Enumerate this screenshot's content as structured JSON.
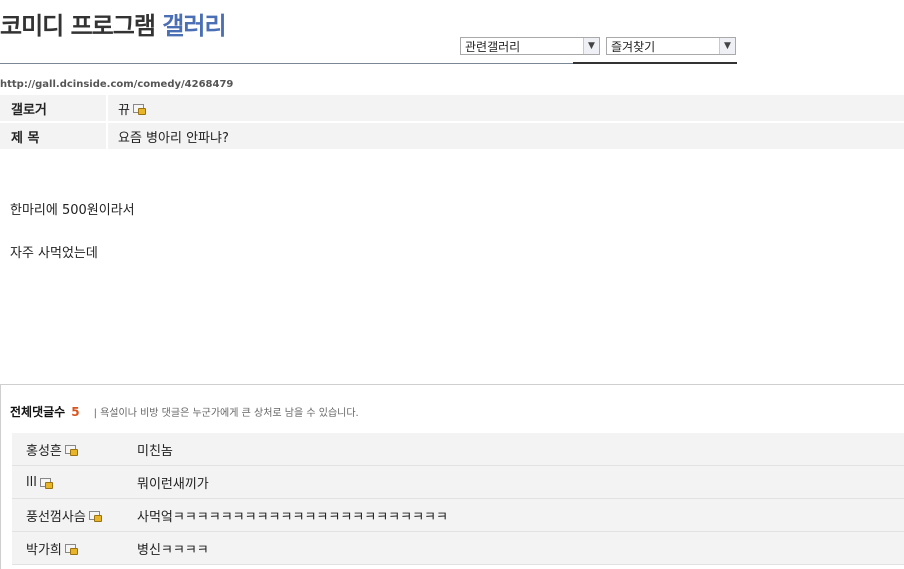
{
  "header": {
    "title_main": "코미디 프로그램",
    "title_accent": "갤러리",
    "related_select": "관련갤러리",
    "favorites_select": "즐겨찾기",
    "url": "http://gall.dcinside.com/comedy/4268479"
  },
  "post": {
    "writer_label": "갤로거",
    "writer": "뀨",
    "subject_label": "제 목",
    "subject": "요즘 병아리 안파냐?",
    "body_lines": [
      "한마리에 500원이라서",
      "자주 사먹었는데"
    ]
  },
  "comments": {
    "title": "전체댓글수",
    "count": "5",
    "notice": "| 욕설이나 비방 댓글은 누군가에게 큰 상처로 남을 수 있습니다.",
    "items": [
      {
        "author": "홍성흔",
        "text": "미친놈"
      },
      {
        "author": "lll",
        "text": "뭐이런새끼가"
      },
      {
        "author": "풍선껌사슴",
        "text": "사먹엌ㅋㅋㅋㅋㅋㅋㅋㅋㅋㅋㅋㅋㅋㅋㅋㅋㅋㅋㅋㅋㅋㅋㅋ"
      },
      {
        "author": "박가희",
        "text": "병신ㅋㅋㅋㅋ"
      }
    ]
  },
  "colors": {
    "accent": "#4b6fb5",
    "count": "#d9531e"
  }
}
